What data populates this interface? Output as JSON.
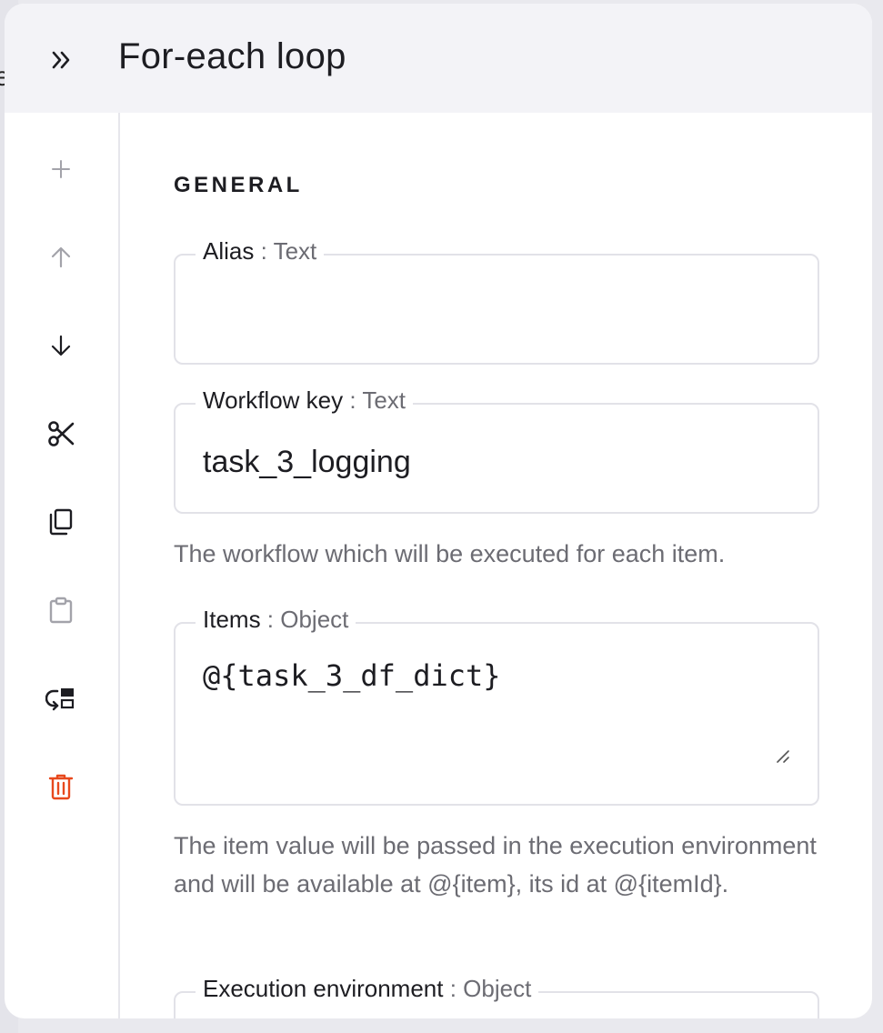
{
  "background": {
    "clipped_text": "e"
  },
  "header": {
    "title": "For-each loop"
  },
  "toolbar": {
    "items": [
      {
        "icon": "plus-icon",
        "action": "add",
        "enabled": false
      },
      {
        "icon": "arrow-up-icon",
        "action": "move-up",
        "enabled": false
      },
      {
        "icon": "arrow-down-icon",
        "action": "move-down",
        "enabled": true
      },
      {
        "icon": "scissors-icon",
        "action": "cut",
        "enabled": true
      },
      {
        "icon": "copy-icon",
        "action": "copy",
        "enabled": true
      },
      {
        "icon": "clipboard-icon",
        "action": "paste",
        "enabled": false
      },
      {
        "icon": "replace-icon",
        "action": "replace",
        "enabled": true
      },
      {
        "icon": "trash-icon",
        "action": "delete",
        "enabled": true,
        "color": "#e8491d"
      }
    ]
  },
  "form": {
    "section_heading": "GENERAL",
    "fields": {
      "alias": {
        "label": "Alias",
        "separator": " : ",
        "type": "Text",
        "value": ""
      },
      "workflow_key": {
        "label": "Workflow key",
        "separator": " : ",
        "type": "Text",
        "value": "task_3_logging",
        "help": "The workflow which will be executed for each item."
      },
      "items": {
        "label": "Items",
        "separator": " : ",
        "type": "Object",
        "value": "@{task_3_df_dict}",
        "help": "The item value will be passed in the execution environment and will be available at @{item}, its id at @{itemId}."
      },
      "execution_environment": {
        "label": "Execution environment",
        "separator": " : ",
        "type": "Object"
      }
    }
  },
  "colors": {
    "accent_danger": "#e8491d",
    "header_bg": "#f3f3f7",
    "muted_text": "#6c6c73",
    "border": "#e2e2e8",
    "disabled_icon": "#a3a3aa"
  }
}
